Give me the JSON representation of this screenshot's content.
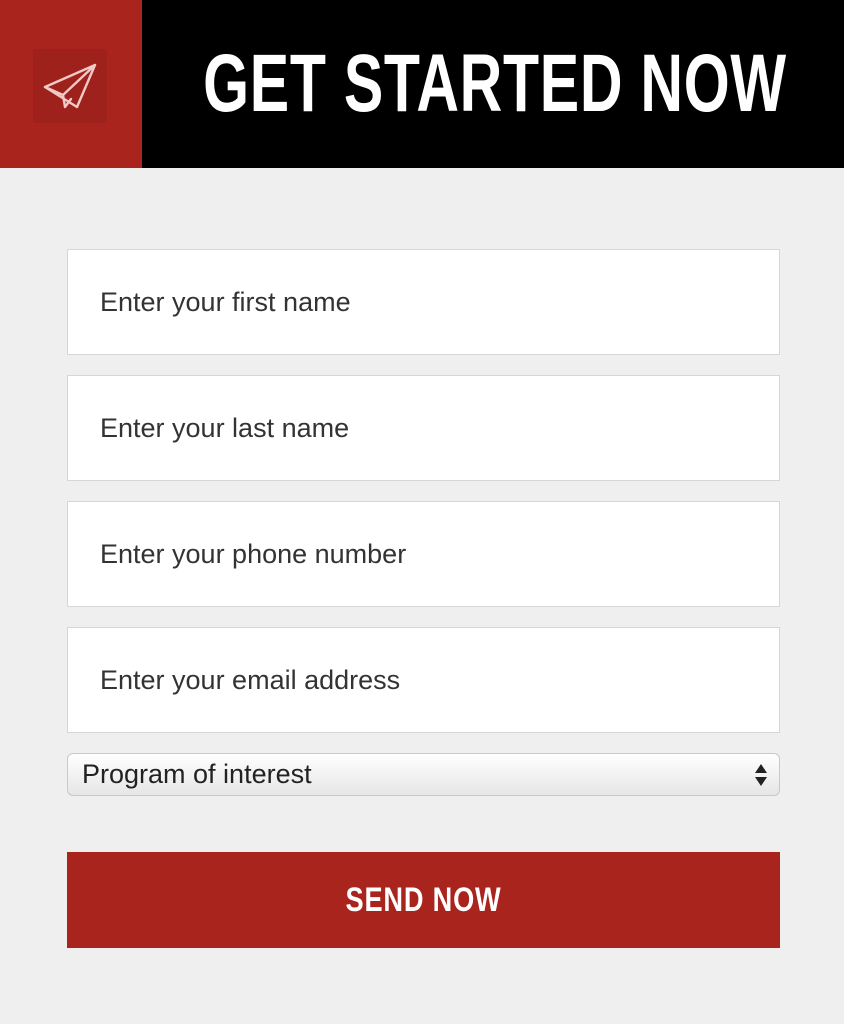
{
  "header": {
    "title": "GET STARTED NOW",
    "icon": "paper-plane-icon",
    "background_color": "#000000",
    "accent_color": "#a8241d"
  },
  "form": {
    "first_name": {
      "placeholder": "Enter your first name",
      "value": ""
    },
    "last_name": {
      "placeholder": "Enter your last name",
      "value": ""
    },
    "phone": {
      "placeholder": "Enter your phone number",
      "value": ""
    },
    "email": {
      "placeholder": "Enter your email address",
      "value": ""
    },
    "program": {
      "selected": "Program of interest",
      "icon": "select-arrows-icon"
    },
    "submit_label": "SEND NOW"
  }
}
